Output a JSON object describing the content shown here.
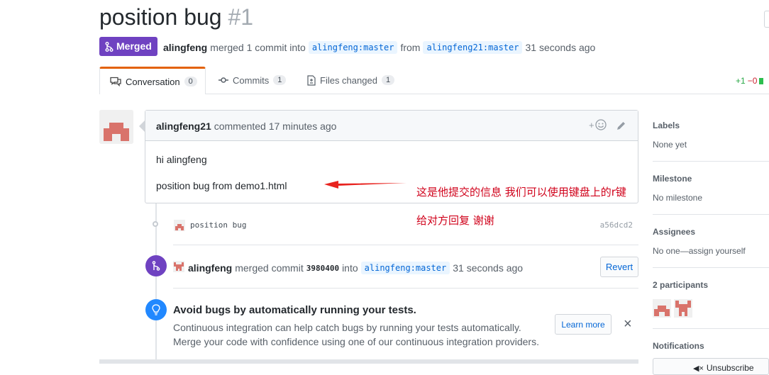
{
  "pr": {
    "title": "position bug",
    "number": "#1",
    "status": "Merged",
    "author": "alingfeng",
    "merge_text": "merged 1 commit into",
    "base_branch": "alingfeng:master",
    "from_text": "from",
    "head_branch": "alingfeng21:master",
    "time": "31 seconds ago"
  },
  "tabs": [
    {
      "label": "Conversation",
      "count": "0",
      "icon": "comment-icon"
    },
    {
      "label": "Commits",
      "count": "1",
      "icon": "commit-icon"
    },
    {
      "label": "Files changed",
      "count": "1",
      "icon": "file-diff-icon"
    }
  ],
  "diffstat": {
    "additions": "+1",
    "deletions": "−0"
  },
  "comment": {
    "author": "alingfeng21",
    "meta": "commented 17 minutes ago",
    "line1": "hi alingfeng",
    "line2": "position bug from demo1.html"
  },
  "commit": {
    "message": "position bug",
    "sha": "a56dcd2"
  },
  "merge_event": {
    "author": "alingfeng",
    "text": "merged commit",
    "sha": "3980400",
    "into": "into",
    "branch": "alingfeng:master",
    "time": "31 seconds ago",
    "revert_label": "Revert"
  },
  "ci_tip": {
    "title": "Avoid bugs by automatically running your tests.",
    "line1": "Continuous integration can help catch bugs by running your tests automatically.",
    "line2": "Merge your code with confidence using one of our continuous integration providers.",
    "learn_more": "Learn more",
    "close": "×"
  },
  "annotation": {
    "line1": "这是他提交的信息 我们可以使用键盘上的r键",
    "line2": "给对方回复 谢谢",
    "color": "#d0021b"
  },
  "sidebar": {
    "labels": {
      "heading": "Labels",
      "value": "None yet"
    },
    "milestone": {
      "heading": "Milestone",
      "value": "No milestone"
    },
    "assignees": {
      "heading": "Assignees",
      "value": "No one—assign yourself"
    },
    "participants": {
      "heading": "2 participants"
    },
    "notifications": {
      "heading": "Notifications",
      "button": "Unsubscribe"
    }
  },
  "colors": {
    "merged": "#6f42c1",
    "link": "#0366d6",
    "active_tab": "#e36209",
    "avatar": "#d9736b"
  }
}
